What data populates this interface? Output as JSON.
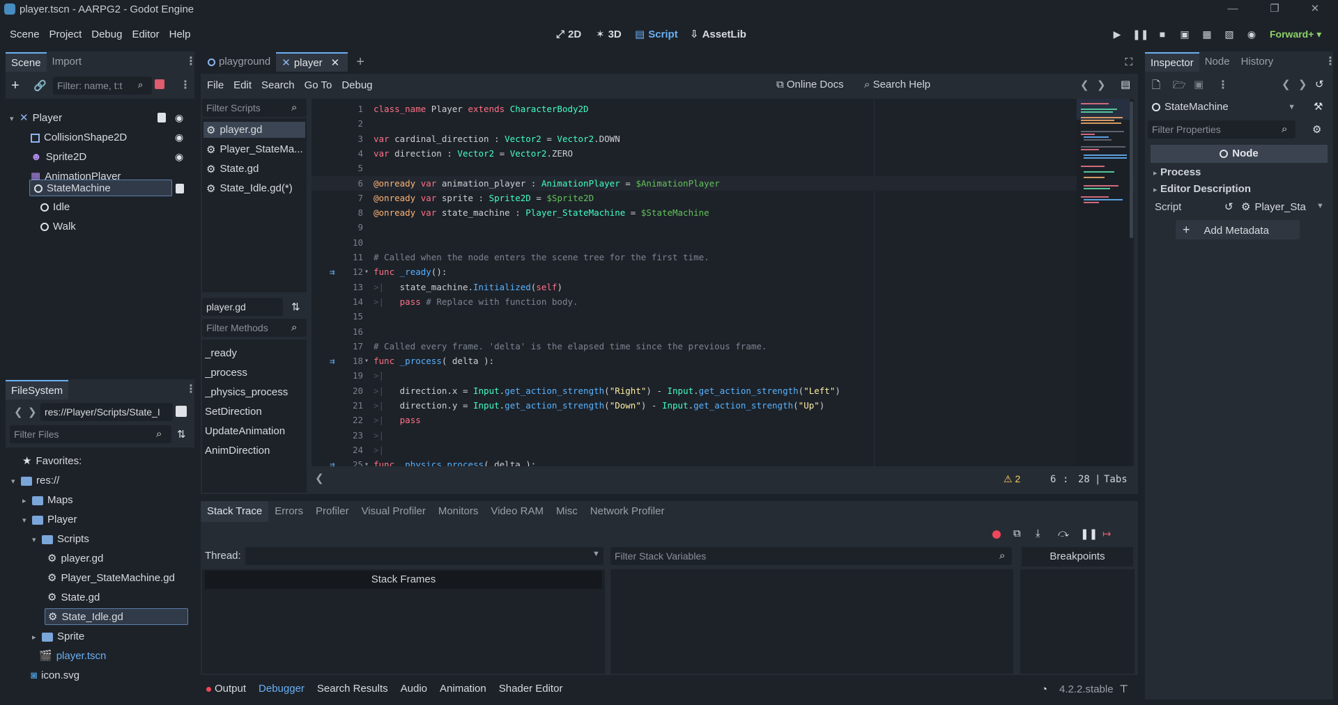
{
  "window": {
    "title": "player.tscn - AARPG2 - Godot Engine"
  },
  "menu": [
    "Scene",
    "Project",
    "Debug",
    "Editor",
    "Help"
  ],
  "workspaces": {
    "w2d": "2D",
    "w3d": "3D",
    "script": "Script",
    "assetlib": "AssetLib"
  },
  "renderer": "Forward+",
  "scene_dock": {
    "tabs": [
      "Scene",
      "Import"
    ],
    "filter_placeholder": "Filter: name, t:t",
    "nodes": [
      "Player",
      "CollisionShape2D",
      "Sprite2D",
      "AnimationPlayer",
      "StateMachine",
      "Idle",
      "Walk"
    ]
  },
  "filesystem": {
    "tab": "FileSystem",
    "path": "res://Player/Scripts/State_I",
    "filter_placeholder": "Filter Files",
    "favorites": "Favorites:",
    "items": [
      "res://",
      "Maps",
      "Player",
      "Scripts",
      "player.gd",
      "Player_StateMachine.gd",
      "State.gd",
      "State_Idle.gd",
      "Sprite",
      "player.tscn",
      "icon.svg"
    ]
  },
  "editor_tabs": [
    "playground",
    "player"
  ],
  "script_menu": [
    "File",
    "Edit",
    "Search",
    "Go To",
    "Debug"
  ],
  "script_links": {
    "docs": "Online Docs",
    "help": "Search Help"
  },
  "scripts": {
    "filter_placeholder": "Filter Scripts",
    "items": [
      "player.gd",
      "Player_StateMa...",
      "State.gd",
      "State_Idle.gd(*)"
    ],
    "current": "player.gd",
    "methods_placeholder": "Filter Methods",
    "methods": [
      "_ready",
      "_process",
      "_physics_process",
      "SetDirection",
      "UpdateAnimation",
      "AnimDirection"
    ]
  },
  "code_lines": [
    {
      "n": "1",
      "html": "<span class=\"kw\">class_name</span> Player <span class=\"kw\">extends</span> <span class=\"ty\">CharacterBody2D</span>"
    },
    {
      "n": "2",
      "html": ""
    },
    {
      "n": "3",
      "html": "<span class=\"kw\">var</span> cardinal_direction : <span class=\"ty\">Vector2</span> = <span class=\"ty\">Vector2</span>.DOWN"
    },
    {
      "n": "4",
      "html": "<span class=\"kw\">var</span> direction : <span class=\"ty\">Vector2</span> = <span class=\"ty\">Vector2</span>.ZERO"
    },
    {
      "n": "5",
      "html": ""
    },
    {
      "n": "6",
      "html": "<span class=\"an\">@onready</span> <span class=\"kw\">var</span> animation_player : <span class=\"ty\">AnimationPlayer</span> = <span class=\"nd\">$AnimationPlayer</span>"
    },
    {
      "n": "7",
      "html": "<span class=\"an\">@onready</span> <span class=\"kw\">var</span> sprite : <span class=\"ty\">Sprite2D</span> = <span class=\"nd\">$Sprite2D</span>"
    },
    {
      "n": "8",
      "html": "<span class=\"an\">@onready</span> <span class=\"kw\">var</span> state_machine : <span class=\"ty\">Player_StateMachine</span> = <span class=\"nd\">$StateMachine</span>"
    },
    {
      "n": "9",
      "html": ""
    },
    {
      "n": "10",
      "html": ""
    },
    {
      "n": "11",
      "html": "<span class=\"cm\"># Called when the node enters the scene tree for the first time.</span>"
    },
    {
      "n": "12",
      "html": "<span class=\"kw\">func</span> <span class=\"fn\">_ready</span>():"
    },
    {
      "n": "13",
      "html": "<span class=\"tabm\">&gt;|</span>   state_machine.<span class=\"fn\">Initialized</span>(<span class=\"kw\">self</span>)"
    },
    {
      "n": "14",
      "html": "<span class=\"tabm\">&gt;|</span>   <span class=\"kw\">pass</span> <span class=\"cm\"># Replace with function body.</span>"
    },
    {
      "n": "15",
      "html": ""
    },
    {
      "n": "16",
      "html": ""
    },
    {
      "n": "17",
      "html": "<span class=\"cm\"># Called every frame. 'delta' is the elapsed time since the previous frame.</span>"
    },
    {
      "n": "18",
      "html": "<span class=\"kw\">func</span> <span class=\"fn\">_process</span>( delta ):"
    },
    {
      "n": "19",
      "html": "<span class=\"tabm\">&gt;|</span>"
    },
    {
      "n": "20",
      "html": "<span class=\"tabm\">&gt;|</span>   direction.x = <span class=\"ty\">Input</span>.<span class=\"fn\">get_action_strength</span>(<span class=\"st\">\"Right\"</span>) - <span class=\"ty\">Input</span>.<span class=\"fn\">get_action_strength</span>(<span class=\"st\">\"Left\"</span>)"
    },
    {
      "n": "21",
      "html": "<span class=\"tabm\">&gt;|</span>   direction.y = <span class=\"ty\">Input</span>.<span class=\"fn\">get_action_strength</span>(<span class=\"st\">\"Down\"</span>) - <span class=\"ty\">Input</span>.<span class=\"fn\">get_action_strength</span>(<span class=\"st\">\"Up\"</span>)"
    },
    {
      "n": "22",
      "html": "<span class=\"tabm\">&gt;|</span>   <span class=\"kw\">pass</span>"
    },
    {
      "n": "23",
      "html": "<span class=\"tabm\">&gt;|</span>"
    },
    {
      "n": "24",
      "html": "<span class=\"tabm\">&gt;|</span>"
    },
    {
      "n": "25",
      "html": "<span class=\"kw\">func</span> <span class=\"fn\">_physics_process</span>( delta ):"
    }
  ],
  "status": {
    "warnings": "2",
    "line": "6",
    "col": "28",
    "indent": "Tabs"
  },
  "debugger": {
    "tabs": [
      "Stack Trace",
      "Errors",
      "Profiler",
      "Visual Profiler",
      "Monitors",
      "Video RAM",
      "Misc",
      "Network Profiler"
    ],
    "thread_label": "Thread:",
    "stack_frames": "Stack Frames",
    "filter_vars": "Filter Stack Variables",
    "breakpoints": "Breakpoints"
  },
  "bottom_tabs": [
    "Output",
    "Debugger",
    "Search Results",
    "Audio",
    "Animation",
    "Shader Editor"
  ],
  "version": "4.2.2.stable",
  "inspector": {
    "tabs": [
      "Inspector",
      "Node",
      "History"
    ],
    "object": "StateMachine",
    "filter_placeholder": "Filter Properties",
    "node_header": "Node",
    "sections": [
      "Process",
      "Editor Description"
    ],
    "script_label": "Script",
    "script_value": "Player_Sta",
    "add_metadata": "Add Metadata"
  }
}
